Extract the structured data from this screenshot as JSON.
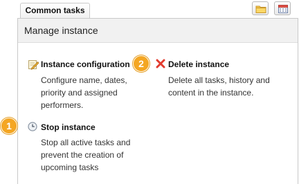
{
  "tab": {
    "label": "Common tasks"
  },
  "toolbar": {
    "icons": [
      "folder-icon",
      "calendar-icon"
    ]
  },
  "panel": {
    "title": "Manage instance"
  },
  "actions": [
    {
      "title": "Instance configuration",
      "description": "Configure name, dates, priority and assigned performers.",
      "icon": "pencil-note-icon"
    },
    {
      "title": "Delete instance",
      "description": "Delete all tasks, history and content in the instance.",
      "icon": "red-x-icon"
    },
    {
      "title": "Stop instance",
      "description": "Stop all active tasks and prevent the creation of upcoming tasks",
      "icon": "stop-clock-icon"
    }
  ],
  "badges": [
    "1",
    "2"
  ],
  "colors": {
    "badge": "#f4a623",
    "delete": "#e23b2e"
  }
}
